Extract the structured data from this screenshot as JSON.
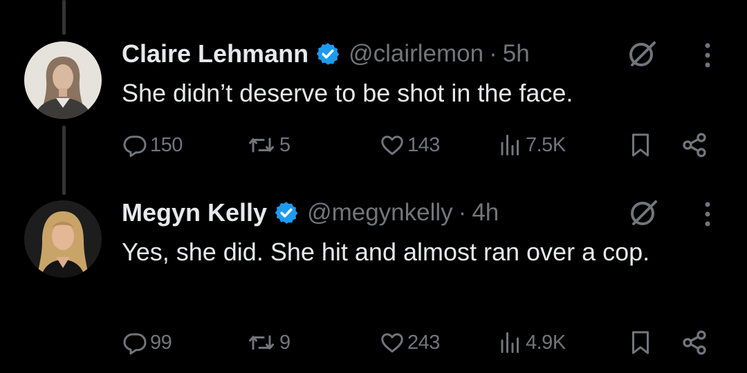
{
  "tweets": [
    {
      "author": {
        "name": "Claire Lehmann",
        "handle": "@clairlemon",
        "verified": true
      },
      "separator": "·",
      "time": "5h",
      "text": "She didn’t deserve to be shot in the face.",
      "stats": {
        "replies": "150",
        "reposts": "5",
        "likes": "143",
        "views": "7.5K"
      }
    },
    {
      "author": {
        "name": "Megyn Kelly",
        "handle": "@megynkelly",
        "verified": true
      },
      "separator": "·",
      "time": "4h",
      "text": "Yes, she did. She hit and almost ran over a cop.",
      "stats": {
        "replies": "99",
        "reposts": "9",
        "likes": "243",
        "views": "4.9K"
      }
    }
  ],
  "icons": {
    "verified_badge": "verified-badge-icon",
    "grok": "grok-icon",
    "more": "more-icon",
    "reply": "reply-icon",
    "repost": "repost-icon",
    "like": "like-icon",
    "views": "views-icon",
    "bookmark": "bookmark-icon",
    "share": "share-icon"
  },
  "colors": {
    "background": "#000000",
    "primary_text": "#e7e9ea",
    "secondary_text": "#71767b",
    "verified_blue": "#1d9bf0",
    "thread_line": "#333639"
  }
}
